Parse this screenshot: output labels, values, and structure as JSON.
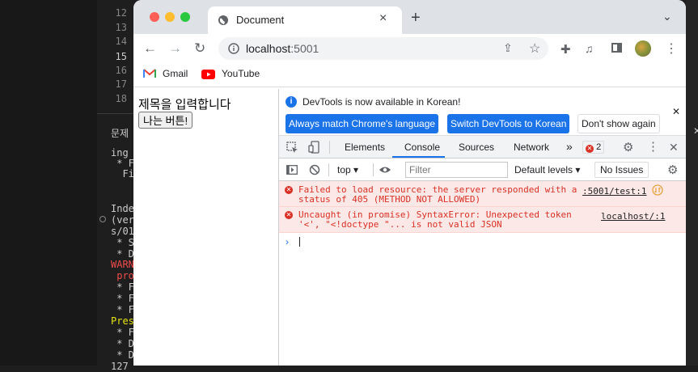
{
  "editor": {
    "line_numbers": [
      "12",
      "13",
      "14",
      "15",
      "16",
      "17",
      "18"
    ],
    "panel_tab": "문제",
    "terminal_lines": [
      {
        "text": "ing",
        "kind": "normal"
      },
      {
        "text": " * F",
        "kind": "normal"
      },
      {
        "text": "  Fi",
        "kind": "normal"
      },
      {
        "text": "Inde",
        "kind": "normal"
      },
      {
        "text": "(ver",
        "kind": "normal"
      },
      {
        "text": "s/01",
        "kind": "normal"
      },
      {
        "text": " * S",
        "kind": "normal"
      },
      {
        "text": " * D",
        "kind": "normal"
      },
      {
        "text": "WARN",
        "kind": "warn"
      },
      {
        "text": " pro",
        "kind": "warn"
      },
      {
        "text": " * F",
        "kind": "normal"
      },
      {
        "text": " * F",
        "kind": "normal"
      },
      {
        "text": " * F",
        "kind": "normal"
      },
      {
        "text": "Pres",
        "kind": "pres"
      },
      {
        "text": " * F",
        "kind": "normal"
      },
      {
        "text": " * D",
        "kind": "normal"
      },
      {
        "text": " * D",
        "kind": "normal"
      },
      {
        "text": "127",
        "kind": "normal"
      }
    ]
  },
  "browser": {
    "tab_title": "Document",
    "url_host": "localhost",
    "url_port": ":5001",
    "bookmarks": [
      {
        "label": "Gmail",
        "icon": "gmail-icon"
      },
      {
        "label": "YouTube",
        "icon": "youtube-icon"
      }
    ]
  },
  "page": {
    "heading": "제목을 입력합니다",
    "button_label": "나는 버튼!"
  },
  "devtools": {
    "info_text": "DevTools is now available in Korean!",
    "info_buttons": {
      "match": "Always match Chrome's language",
      "switch": "Switch DevTools to Korean",
      "dismiss": "Don't show again"
    },
    "tabs": [
      "Elements",
      "Console",
      "Sources",
      "Network"
    ],
    "active_tab": "Console",
    "more_tabs": "»",
    "error_count": "2",
    "context": "top",
    "filter_placeholder": "Filter",
    "levels": "Default levels",
    "issues": "No Issues",
    "messages": [
      {
        "text": "Failed to load resource: the server responded with a\nstatus of 405 (METHOD NOT ALLOWED)",
        "source": ":5001/test:1"
      },
      {
        "text": "Uncaught (in promise) SyntaxError: Unexpected token\n'<', \"<!doctype \"... is not valid JSON",
        "source": "localhost/:1"
      }
    ],
    "prompt": "›"
  },
  "colors": {
    "accent": "#1a73e8",
    "error": "#d93025",
    "error_bg": "#fce8e6"
  }
}
